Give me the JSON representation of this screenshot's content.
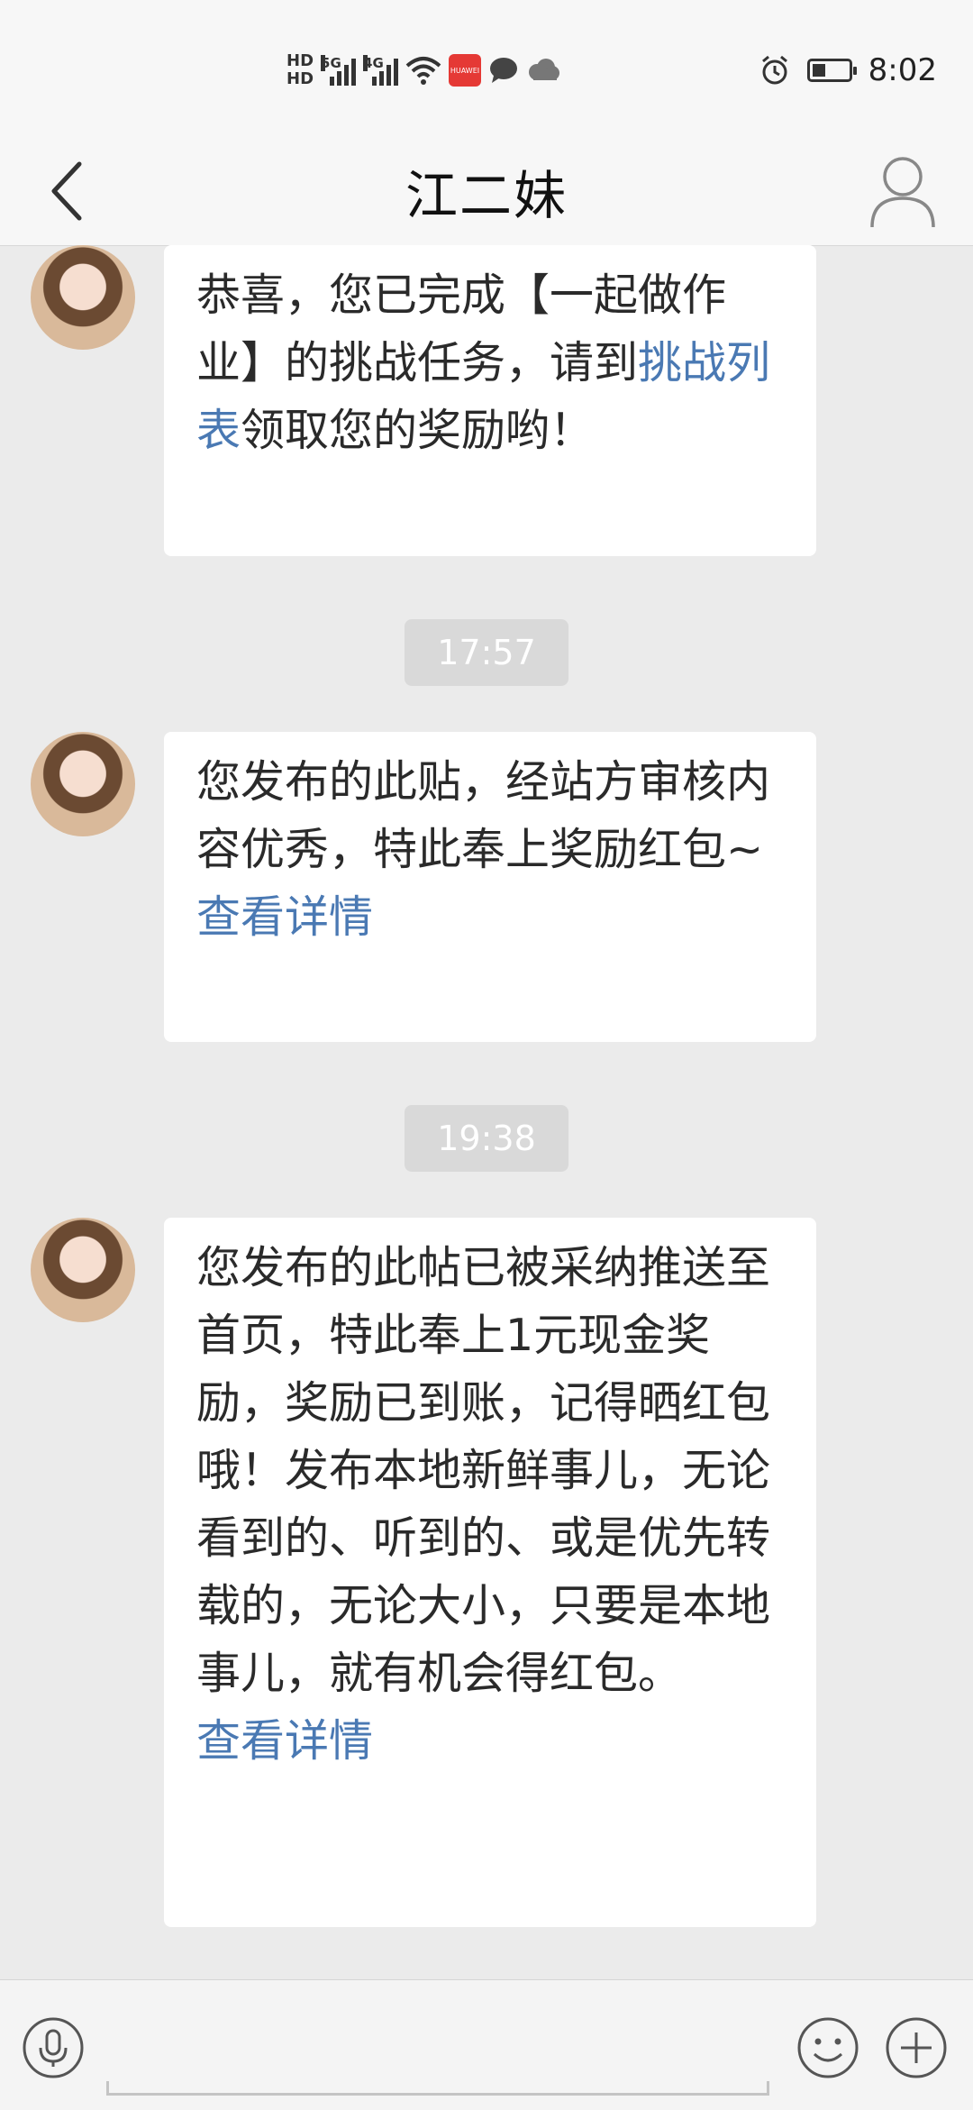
{
  "status_bar": {
    "hd1": "HD",
    "hd2": "HD",
    "sim1_net": "5G",
    "sim2_net": "4G",
    "huawei_badge": "HUAWEI",
    "time": "8:02"
  },
  "header": {
    "title": "江二妹"
  },
  "messages": [
    {
      "text_before": "恭喜，您已完成【一起做作业】的挑战任务，请到",
      "link": "挑战列表",
      "text_after": "领取您的奖励哟！"
    },
    {
      "timestamp": "17:57",
      "text": "您发布的此贴，经站方审核内容优秀，特此奉上奖励红包~",
      "link": "查看详情"
    },
    {
      "timestamp": "19:38",
      "text": "您发布的此帖已被采纳推送至首页，特此奉上1元现金奖励，奖励已到账，记得晒红包哦！发布本地新鲜事儿，无论看到的、听到的、或是优先转载的，无论大小，只要是本地事儿，就有机会得红包。",
      "link": "查看详情"
    }
  ],
  "input_bar": {
    "voice_icon": "mic-icon",
    "emoji_icon": "smiley-icon",
    "more_icon": "plus-icon"
  },
  "colors": {
    "background": "#ebebeb",
    "link": "#4a79b3",
    "bubble": "#ffffff",
    "timestamp_chip": "#d9d9d9"
  }
}
